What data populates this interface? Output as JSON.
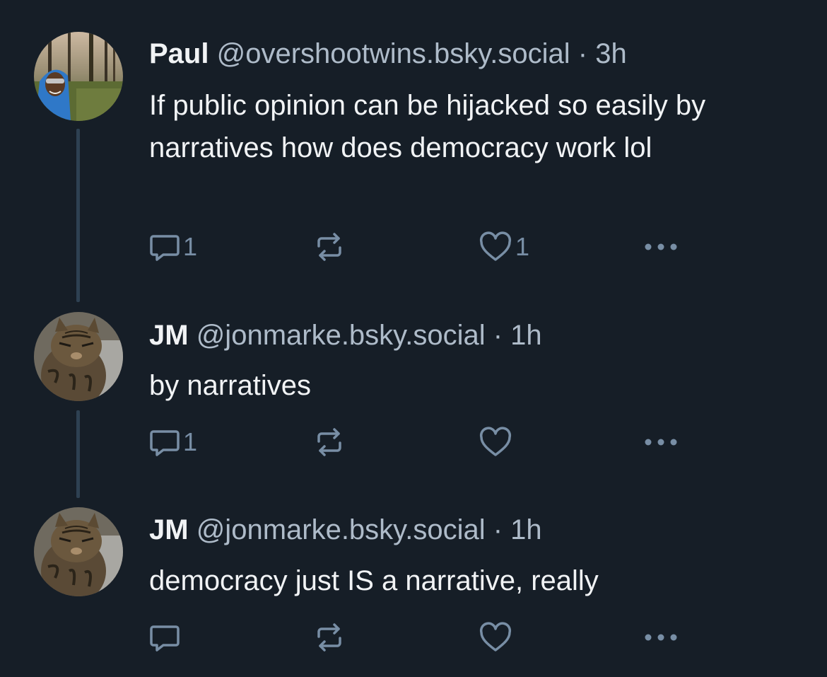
{
  "posts": [
    {
      "author": "Paul",
      "handle": "@overshootwins.bsky.social",
      "separator": "·",
      "time": "3h",
      "text": "If public opinion can be hijacked so easily by narratives how does democracy work lol",
      "reply_count": "1",
      "repost_count": "",
      "like_count": "1",
      "avatar_icon": "avatar-photo-person-forest"
    },
    {
      "author": "JM",
      "handle": "@jonmarke.bsky.social",
      "separator": "·",
      "time": "1h",
      "text": "by narratives",
      "reply_count": "1",
      "repost_count": "",
      "like_count": "",
      "avatar_icon": "avatar-photo-tabby-cat"
    },
    {
      "author": "JM",
      "handle": "@jonmarke.bsky.social",
      "separator": "·",
      "time": "1h",
      "text": "democracy just IS a narrative, really",
      "reply_count": "",
      "repost_count": "",
      "like_count": "",
      "avatar_icon": "avatar-photo-tabby-cat"
    }
  ],
  "icons": {
    "reply": "reply-icon",
    "repost": "repost-icon",
    "like": "heart-icon",
    "more": "more-options-icon"
  },
  "colors": {
    "background": "#161e27",
    "text_primary": "#f1f3f5",
    "text_secondary": "#aebbc9",
    "icon": "#788ea5",
    "thread_line": "#2e4152"
  }
}
